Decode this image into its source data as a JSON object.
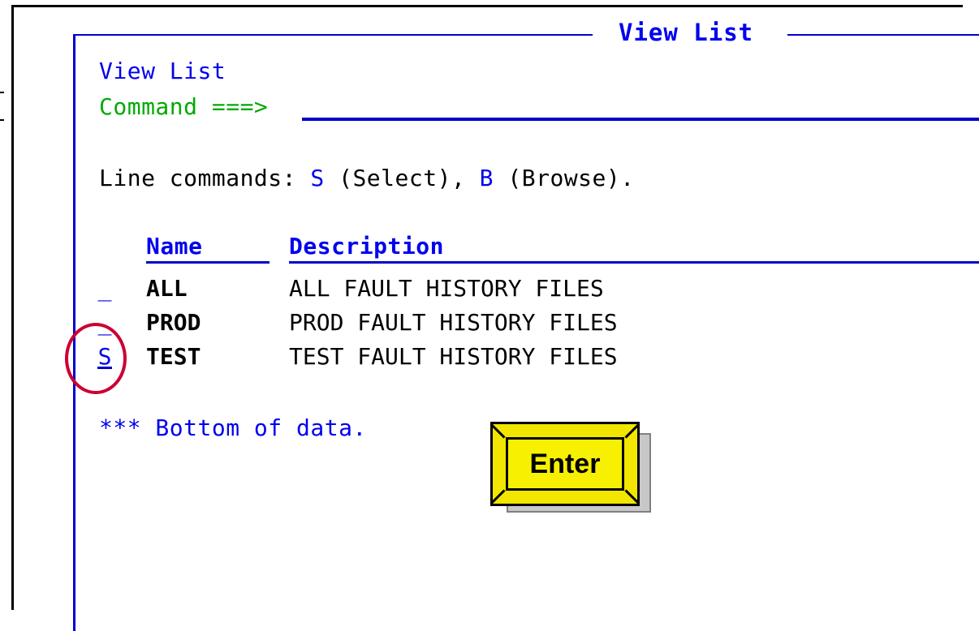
{
  "panel": {
    "title": "View List"
  },
  "screen": {
    "heading": "View List",
    "command_label": "Command ===>",
    "command_value": "",
    "line_commands_prefix": "Line commands: ",
    "line_cmd_s": "S",
    "line_cmd_s_desc": " (Select), ",
    "line_cmd_b": "B",
    "line_cmd_b_desc": " (Browse).",
    "bottom_of_data": "*** Bottom of data."
  },
  "table": {
    "headers": {
      "name": "Name",
      "description": "Description"
    },
    "rows": [
      {
        "selector": "_",
        "name": "ALL",
        "description": "ALL FAULT HISTORY FILES"
      },
      {
        "selector": "_",
        "name": "PROD",
        "description": "PROD FAULT HISTORY FILES"
      },
      {
        "selector": "S",
        "name": "TEST",
        "description": "TEST FAULT HISTORY FILES"
      }
    ]
  },
  "enter_button": {
    "label": "Enter"
  },
  "colors": {
    "field_blue": "#0000ee",
    "command_green": "#00aa00",
    "highlight_red": "#cc0033",
    "button_yellow": "#f2e600"
  }
}
